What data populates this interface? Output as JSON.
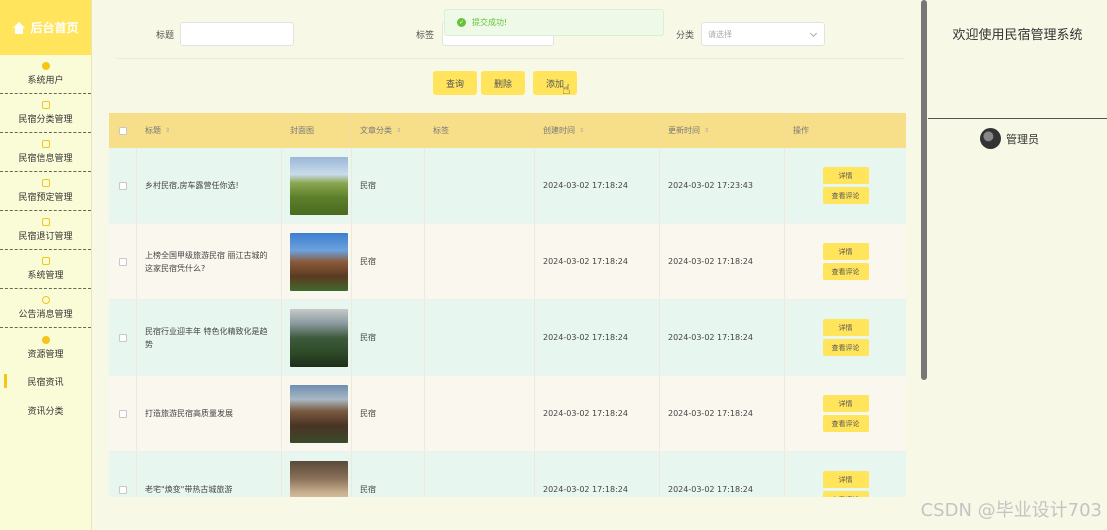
{
  "sidebar": {
    "brand": "后台首页",
    "items": [
      {
        "label": "系统用户",
        "icon": "user-icon"
      },
      {
        "label": "民宿分类管理",
        "icon": "edit-icon"
      },
      {
        "label": "民宿信息管理",
        "icon": "edit-icon"
      },
      {
        "label": "民宿预定管理",
        "icon": "edit-icon"
      },
      {
        "label": "民宿退订管理",
        "icon": "edit-icon"
      },
      {
        "label": "系统管理",
        "icon": "settings-icon"
      },
      {
        "label": "公告消息管理",
        "icon": "info-icon"
      },
      {
        "label": "资源管理",
        "icon": "bulb-icon"
      }
    ],
    "sub_items": [
      {
        "label": "民宿资讯",
        "active": true
      },
      {
        "label": "资讯分类",
        "active": false
      }
    ]
  },
  "search": {
    "title_label": "标题",
    "title_value": "",
    "tag_label": "标签",
    "tag_value": "",
    "category_label": "分类",
    "category_placeholder": "请选择"
  },
  "toast": {
    "message": "提交成功!"
  },
  "actions": {
    "query": "查询",
    "delete": "删除",
    "add": "添加"
  },
  "table": {
    "columns": [
      "标题",
      "封面图",
      "文章分类",
      "标签",
      "创建时间",
      "更新时间",
      "操作"
    ],
    "rows": [
      {
        "title": "乡村民宿,房车露营任你选!",
        "category": "民宿",
        "tag": "",
        "created": "2024-03-02 17:18:24",
        "updated": "2024-03-02 17:23:43"
      },
      {
        "title": "上榜全国甲级旅游民宿 丽江古城的这家民宿凭什么?",
        "category": "民宿",
        "tag": "",
        "created": "2024-03-02 17:18:24",
        "updated": "2024-03-02 17:18:24"
      },
      {
        "title": "民宿行业迎丰年 特色化精致化是趋势",
        "category": "民宿",
        "tag": "",
        "created": "2024-03-02 17:18:24",
        "updated": "2024-03-02 17:18:24"
      },
      {
        "title": "打造旅游民宿高质量发展",
        "category": "民宿",
        "tag": "",
        "created": "2024-03-02 17:18:24",
        "updated": "2024-03-02 17:18:24"
      },
      {
        "title": "老宅\"焕变\"带热古城旅游",
        "category": "民宿",
        "tag": "",
        "created": "2024-03-02 17:18:24",
        "updated": "2024-03-02 17:18:24"
      }
    ],
    "detail_label": "详情",
    "comment_label": "查看评论"
  },
  "right_panel": {
    "welcome": "欢迎使用民宿管理系统",
    "user": "管理员"
  },
  "watermark": "CSDN @毕业设计703",
  "colors": {
    "accent": "#ffe45c",
    "header": "#f7df8a",
    "row_green": "#e7f6ee",
    "row_cream": "#faf7ee",
    "success": "#67c23a"
  }
}
